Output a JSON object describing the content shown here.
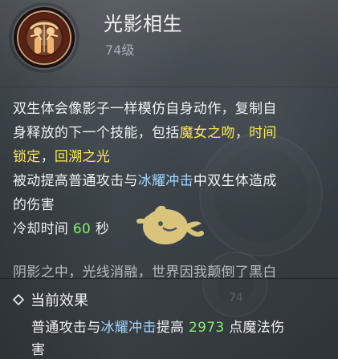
{
  "skill": {
    "title": "光影相生",
    "level": "74级"
  },
  "description": {
    "line1": "双生体会像影子一样模仿自身动作，复制自",
    "line2_prefix": "身释放的下一个技能，包括",
    "line2_skill1": "魔女之吻",
    "line2_sep": "，",
    "line2_skill2": "时间",
    "line3_skill2_cont": "锁定",
    "line3_sep": "，",
    "line3_skill3": "回溯之光",
    "line4_prefix": "被动提高普通攻击与",
    "line4_skill": "冰耀冲击",
    "line4_suffix": "中双生体造成",
    "line5": "的伤害",
    "cooldown_prefix": "冷却时间 ",
    "cooldown_value": "60",
    "cooldown_suffix": " 秒",
    "flavor": "阴影之中，光线消融，世界因我颠倒了黑白"
  },
  "current_effect": {
    "title": "当前效果",
    "text_prefix": "普通攻击与",
    "text_skill": "冰耀冲击",
    "text_mid": "提高 ",
    "text_value": "2973",
    "text_suffix": " 点魔法伤",
    "text_line2": "害"
  },
  "watermark": {
    "number": "74"
  },
  "icons": {
    "skill": "twin-figure-icon",
    "effect": "diamond-bullet-icon",
    "watermark": "cartoon-bird-watermark-icon"
  },
  "colors": {
    "skill_highlight_yellow": "#ffe84c",
    "skill_highlight_blue": "#a5d8ff",
    "value_green": "#7ff06a",
    "text_main": "#eef1f2",
    "text_muted": "#b4babf"
  }
}
